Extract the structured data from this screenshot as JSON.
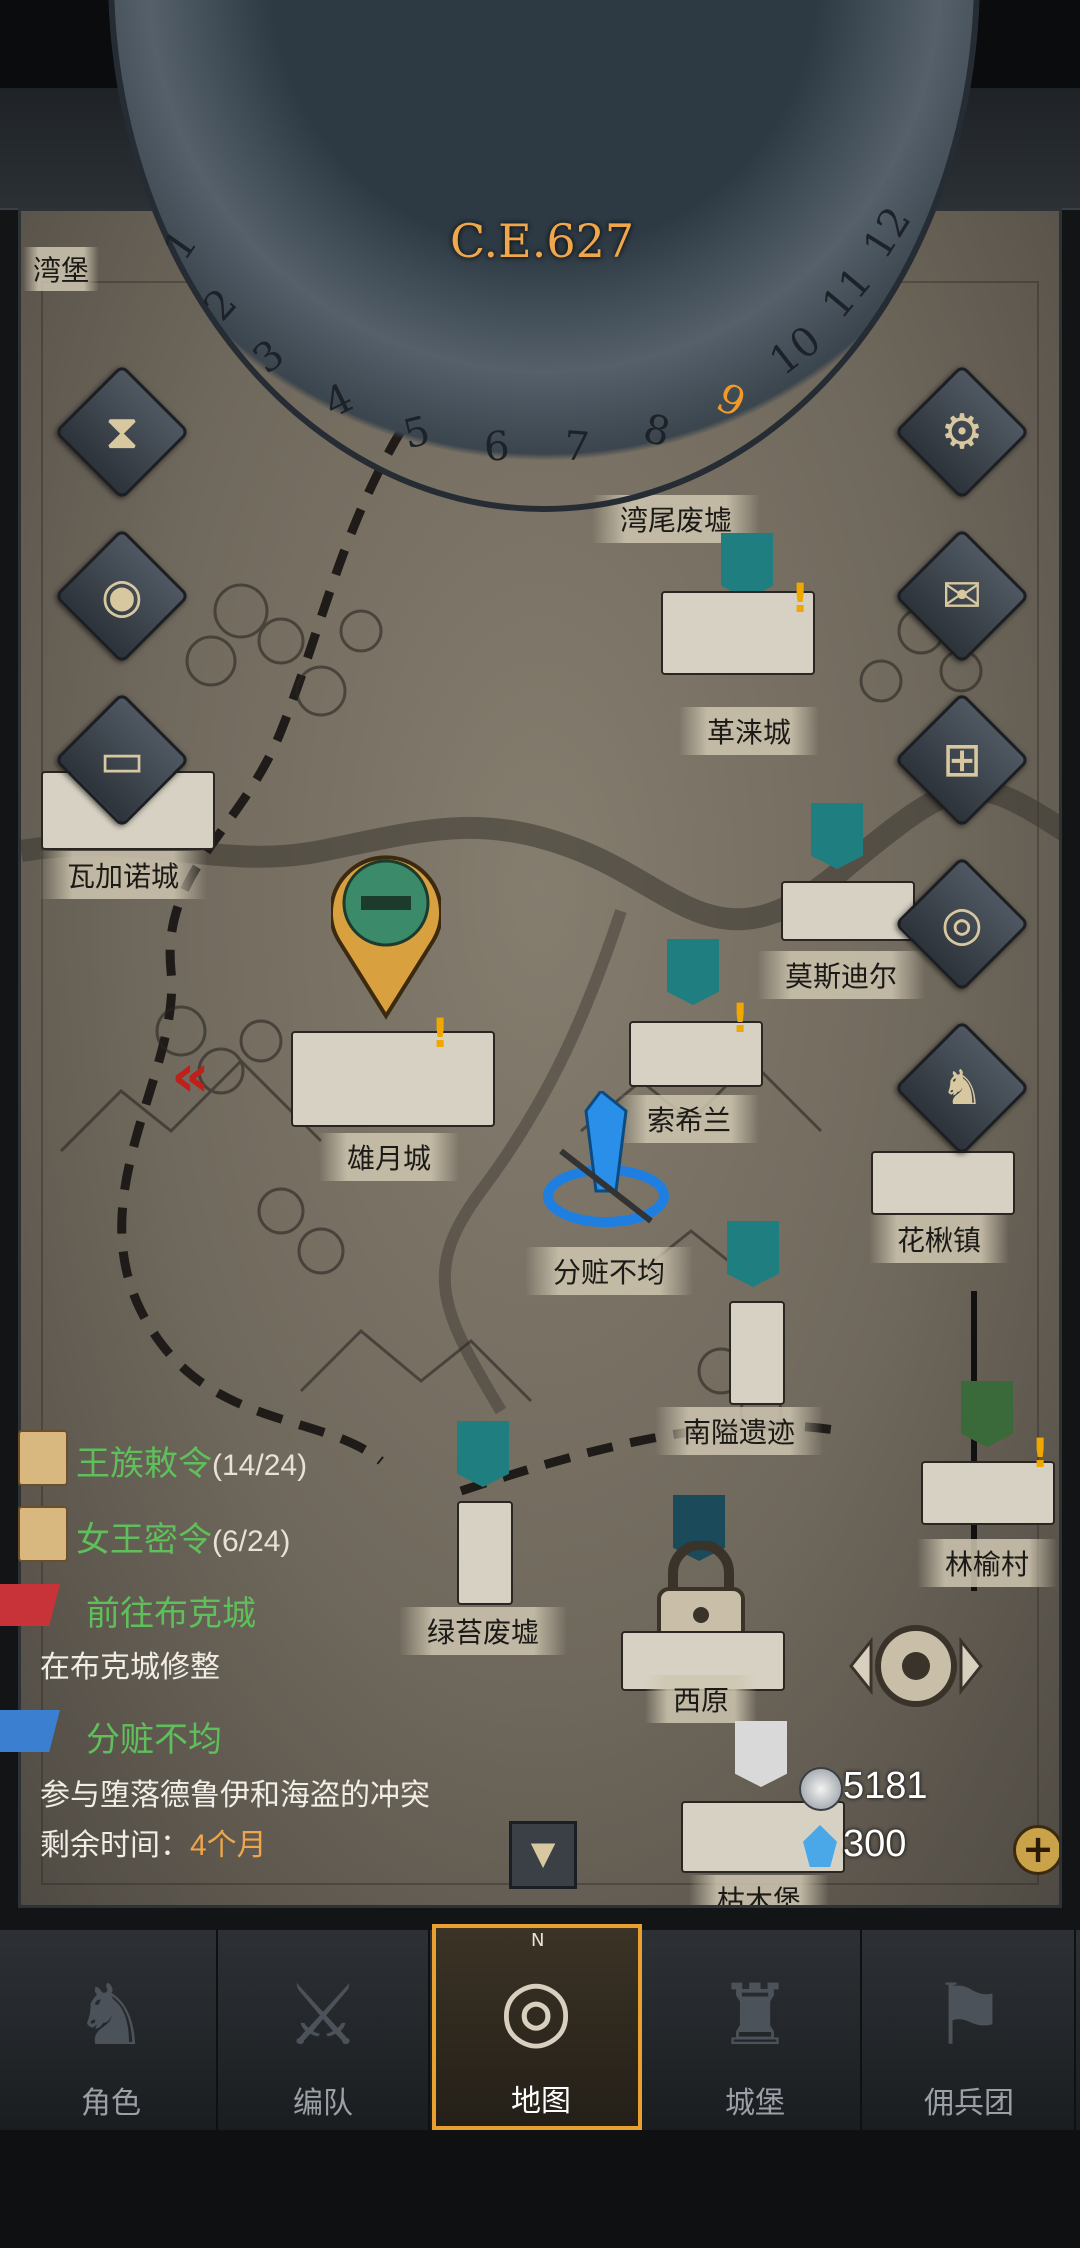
{
  "calendar": {
    "year": "C.E.627",
    "months": [
      "1",
      "2",
      "3",
      "4",
      "5",
      "6",
      "7",
      "8",
      "9",
      "10",
      "11",
      "12"
    ],
    "current_month": "9"
  },
  "map": {
    "corner_label": "湾堡",
    "locations": {
      "wanwei": "湾尾废墟",
      "gelai": "革涞城",
      "wajianuo": "瓦加诺城",
      "mosidier": "莫斯迪尔",
      "xiongyue": "雄月城",
      "suoxilan": "索希兰",
      "huaqiu": "花楸镇",
      "fenzang_event": "分赃不均",
      "nanyi": "南隘遗迹",
      "lintou": "林榆村",
      "lvtai": "绿苔废墟",
      "xiyuan": "西原",
      "kumu": "枯木堡"
    }
  },
  "quests": {
    "royal_decree": {
      "label": "王族敕令",
      "progress": "(14/24)"
    },
    "queen_decree": {
      "label": "女王密令",
      "progress": "(6/24)"
    },
    "mission1": {
      "title": "前往布克城",
      "desc": "在布克城修整"
    },
    "mission2": {
      "title": "分赃不均",
      "desc": "参与堕落德鲁伊和海盗的冲突",
      "time_prefix": "剩余时间：",
      "time_value": "4个月"
    }
  },
  "resources": {
    "silver": "5181",
    "crystal": "300"
  },
  "side_buttons": [
    "hourglass-icon",
    "bag-icon",
    "scroll-icon",
    "gear-icon",
    "mail-icon",
    "window-icon",
    "coin-icon",
    "knight-icon"
  ],
  "tabs": [
    {
      "label": "角色"
    },
    {
      "label": "编队"
    },
    {
      "label": "地图"
    },
    {
      "label": "城堡"
    },
    {
      "label": "佣兵团"
    }
  ],
  "compass_letter": "N",
  "colors": {
    "accent": "#e8a030",
    "quest_green": "#5fbf5a",
    "time_orange": "#f0a64a"
  }
}
